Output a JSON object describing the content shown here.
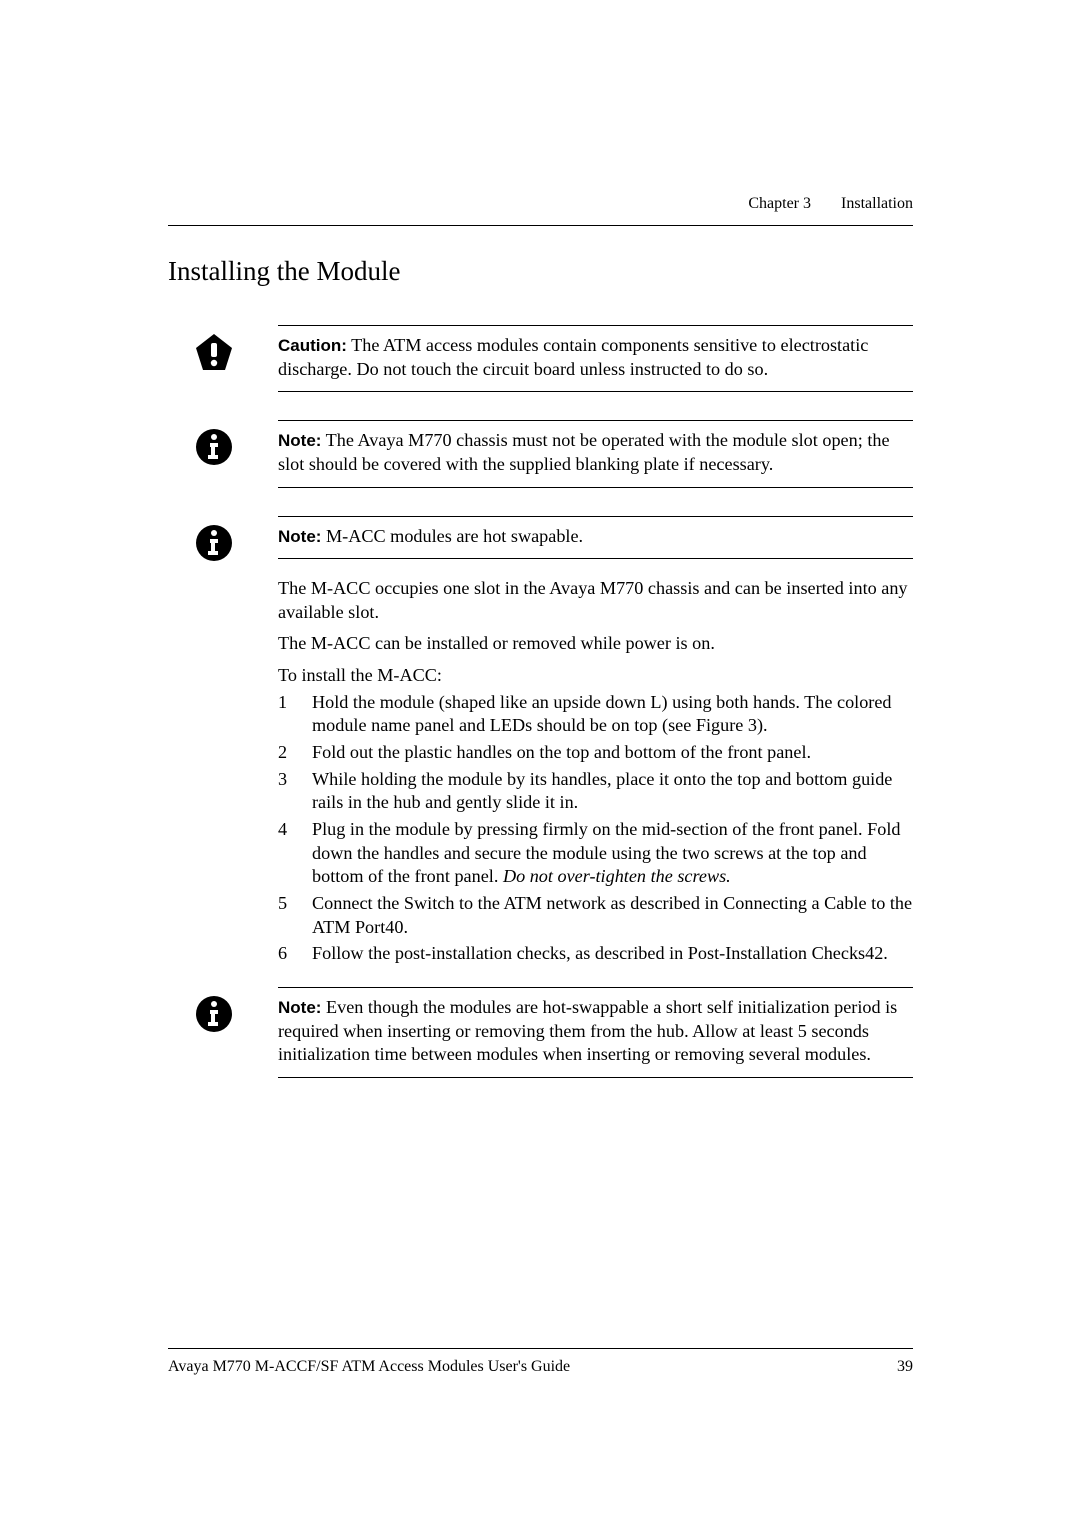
{
  "header": {
    "chapter": "Chapter 3",
    "title": "Installation"
  },
  "section_title": "Installing the Module",
  "caution": {
    "label": "Caution:",
    "text": "The ATM access modules contain components sensitive to electrostatic discharge. Do not touch the circuit board unless instructed to do so."
  },
  "note1": {
    "label": "Note:",
    "text": "The Avaya M770 chassis must not be operated with the module slot open; the slot should be covered with the supplied blanking plate if necessary."
  },
  "note2": {
    "label": "Note:",
    "text": "M-ACC modules are hot swapable."
  },
  "intro": {
    "p1": "The M-ACC occupies one slot in the Avaya M770 chassis and can be inserted into any available slot.",
    "p2": "The M-ACC can be installed or removed while power is on.",
    "p3": "To install the M-ACC:"
  },
  "steps": {
    "s1": "Hold the module (shaped like an upside down L) using both hands. The colored module name panel and LEDs should be on top (see Figure 3).",
    "s2": "Fold out the plastic handles on the top and bottom of the front panel.",
    "s3": "While holding the module by its handles, place it onto the top and bottom guide rails in the hub and gently slide it in.",
    "s4a": "Plug in the module by pressing firmly on the mid-section of the front panel. Fold down the handles and secure the module using the two screws at the top and bottom of the front panel. ",
    "s4b": "Do not over-tighten the screws.",
    "s5": "Connect the Switch to the ATM network as described in Connecting a Cable to the ATM Port40.",
    "s6": "Follow the post-installation checks, as described in Post-Installation Checks42."
  },
  "note3": {
    "label": "Note:",
    "text": "Even though the modules are hot-swappable a short self initialization period is required when inserting or removing them from the hub. Allow at least 5 seconds initialization time between modules when inserting or removing several modules."
  },
  "footer": {
    "doc_title": "Avaya M770 M-ACCF/SF ATM Access Modules User's Guide",
    "page": "39"
  }
}
